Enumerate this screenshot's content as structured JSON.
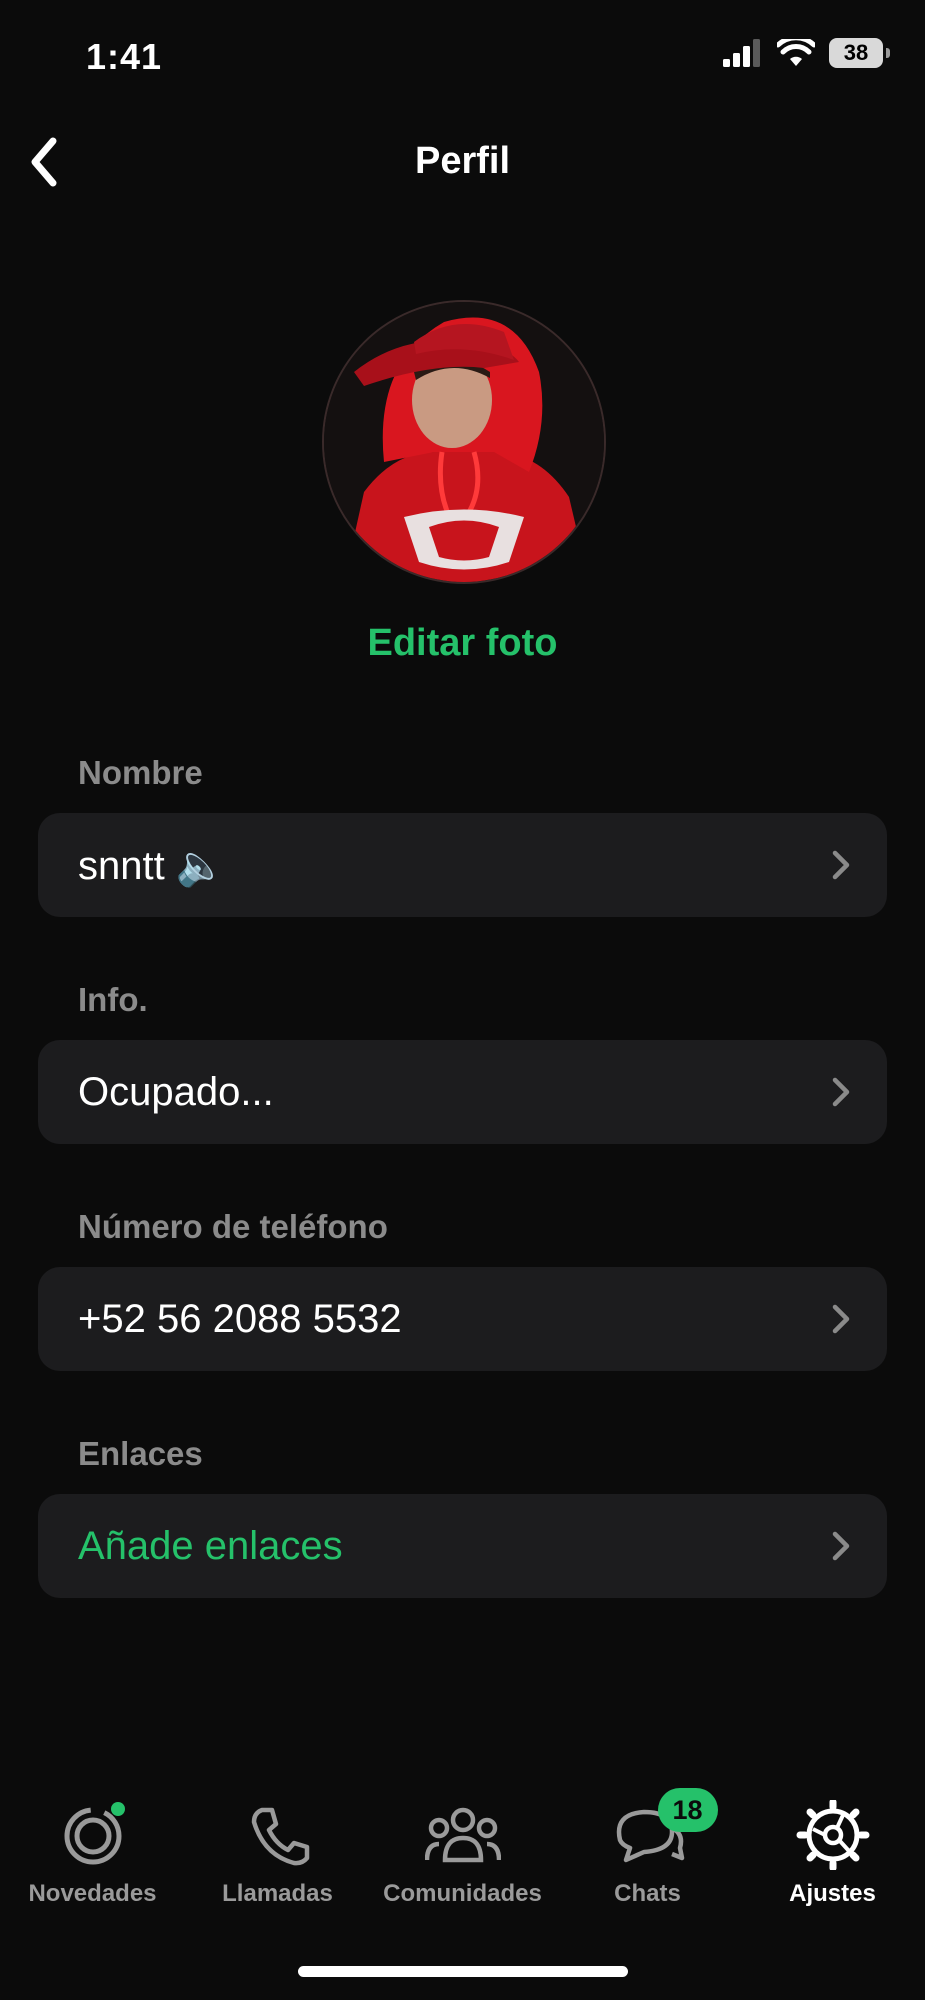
{
  "status_bar": {
    "time": "1:41",
    "battery": "38"
  },
  "header": {
    "title": "Perfil",
    "back_icon": "chevron-left-icon"
  },
  "profile": {
    "edit_photo_label": "Editar foto"
  },
  "sections": {
    "name": {
      "label": "Nombre",
      "value": "snntt 🔈"
    },
    "info": {
      "label": "Info.",
      "value": "Ocupado..."
    },
    "phone": {
      "label": "Número de teléfono",
      "value": "+52 56 2088 5532"
    },
    "links": {
      "label": "Enlaces",
      "value": "Añade enlaces"
    }
  },
  "tabbar": {
    "items": [
      {
        "label": "Novedades",
        "icon": "updates-icon"
      },
      {
        "label": "Llamadas",
        "icon": "phone-icon"
      },
      {
        "label": "Comunidades",
        "icon": "communities-icon"
      },
      {
        "label": "Chats",
        "icon": "chats-icon",
        "badge": "18"
      },
      {
        "label": "Ajustes",
        "icon": "settings-icon",
        "active": true
      }
    ]
  },
  "colors": {
    "accent": "#25c16a",
    "background": "#0b0b0b",
    "row": "#1c1c1e",
    "label": "#8b8b8b"
  }
}
